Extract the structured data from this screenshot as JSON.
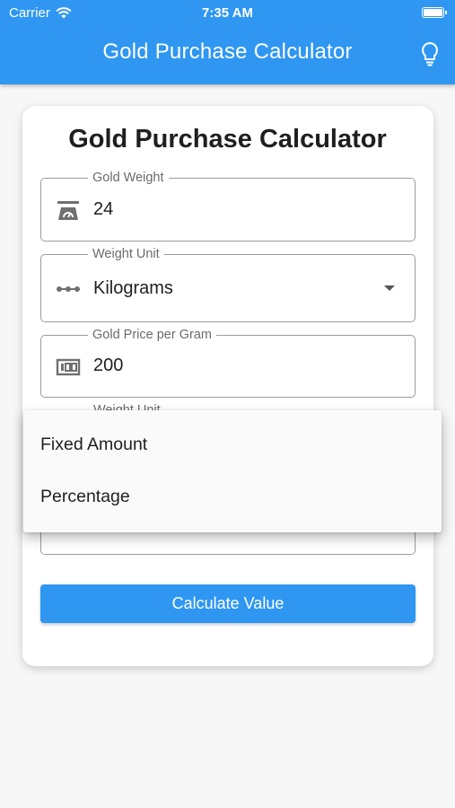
{
  "status_bar": {
    "carrier": "Carrier",
    "time": "7:35 AM"
  },
  "app_bar": {
    "title": "Gold Purchase Calculator",
    "action_icon": "lightbulb-icon"
  },
  "card": {
    "title": "Gold Purchase Calculator",
    "fields": {
      "gold_weight": {
        "label": "Gold Weight",
        "value": "24",
        "icon": "scale-icon"
      },
      "weight_unit": {
        "label": "Weight Unit",
        "value": "Kilograms",
        "icon": "linear-scale-icon"
      },
      "price_per_gram": {
        "label": "Gold Price per Gram",
        "value": "200",
        "icon": "money-icon"
      },
      "hidden_field": {
        "label": "Weight Unit"
      }
    },
    "menu": {
      "items": [
        "Fixed Amount",
        "Percentage"
      ]
    },
    "calculate_label": "Calculate Value"
  },
  "colors": {
    "primary": "#2f97f2",
    "background": "#f7f7f7",
    "card": "#ffffff"
  }
}
